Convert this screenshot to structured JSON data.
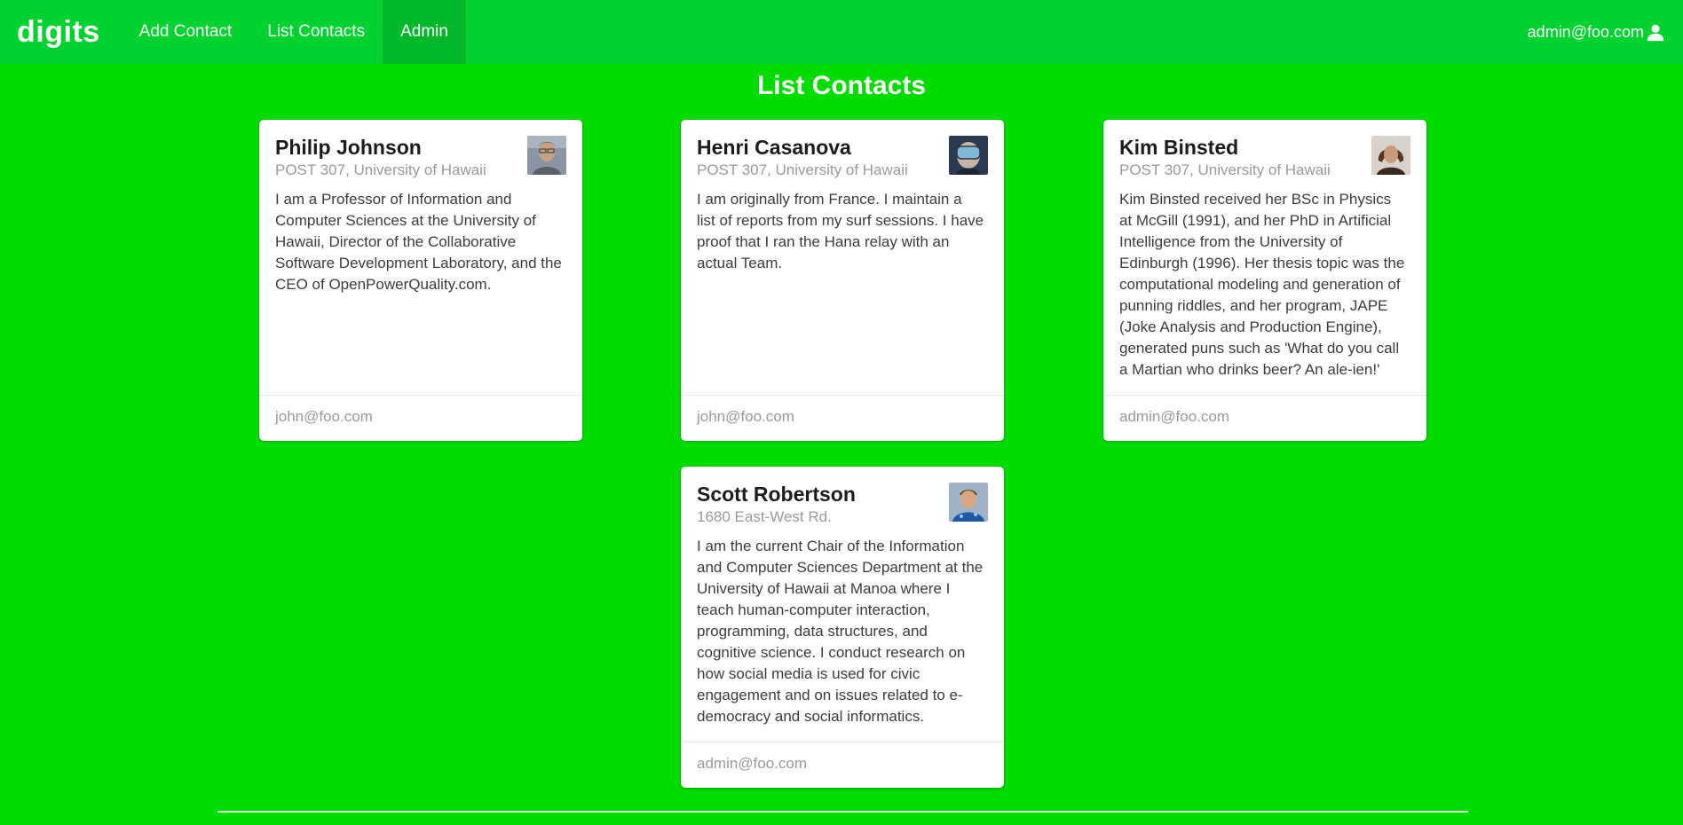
{
  "navbar": {
    "brand": "digits",
    "items": [
      {
        "label": "Add Contact"
      },
      {
        "label": "List Contacts"
      },
      {
        "label": "Admin"
      }
    ],
    "user": "admin@foo.com",
    "colors": {
      "navbar": "#00d32f",
      "active": "#00b82a",
      "page": "#00dc00"
    }
  },
  "main": {
    "title": "List Contacts",
    "contacts": [
      {
        "name": "Philip Johnson",
        "address": "POST 307, University of Hawaii",
        "description": "I am a Professor of Information and Computer Sciences at the University of Hawaii, Director of the Collaborative Software Development Laboratory, and the CEO of OpenPowerQuality.com.",
        "owner": "john@foo.com",
        "avatar": "man-with-glasses-photo"
      },
      {
        "name": "Henri Casanova",
        "address": "POST 307, University of Hawaii",
        "description": "I am originally from France. I maintain a list of reports from my surf sessions. I have proof that I ran the Hana relay with an actual Team.",
        "owner": "john@foo.com",
        "avatar": "man-with-dive-mask-photo"
      },
      {
        "name": "Kim Binsted",
        "address": "POST 307, University of Hawaii",
        "description": "Kim Binsted received her BSc in Physics at McGill (1991), and her PhD in Artificial Intelligence from the University of Edinburgh (1996). Her thesis topic was the computational modeling and generation of punning riddles, and her program, JAPE (Joke Analysis and Production Engine), generated puns such as 'What do you call a Martian who drinks beer? An ale-ien!'",
        "owner": "admin@foo.com",
        "avatar": "woman-portrait-photo"
      },
      {
        "name": "Scott Robertson",
        "address": "1680 East-West Rd.",
        "description": "I am the current Chair of the Information and Computer Sciences Department at the University of Hawaii at Manoa where I teach human-computer interaction, programming, data structures, and cognitive science. I conduct research on how social media is used for civic engagement and on issues related to e-democracy and social informatics.",
        "owner": "admin@foo.com",
        "avatar": "man-in-blue-shirt-photo"
      }
    ]
  }
}
